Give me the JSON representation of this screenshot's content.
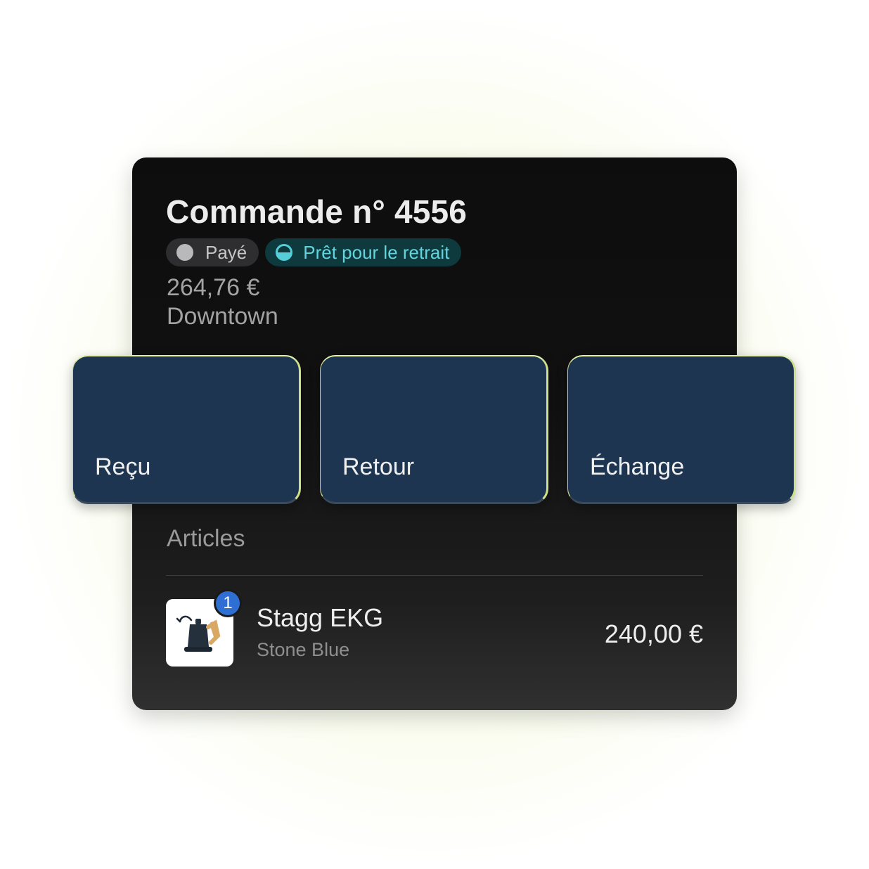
{
  "order": {
    "title": "Commande n° 4556",
    "badges": {
      "payment": "Payé",
      "fulfillment": "Prêt pour le retrait"
    },
    "amount": "264,76 €",
    "location": "Downtown"
  },
  "actions": [
    {
      "label": "Reçu"
    },
    {
      "label": "Retour"
    },
    {
      "label": "Échange"
    }
  ],
  "articles": {
    "title": "Articles",
    "items": [
      {
        "name": "Stagg EKG",
        "variant": "Stone Blue",
        "price": "240,00 €",
        "quantity": "1",
        "icon": "kettle-icon"
      }
    ]
  },
  "colors": {
    "card_bg": "#0d0d0d",
    "action_bg": "#1d3550",
    "action_border": "#e2f2a6",
    "ready_badge_bg": "#0e3a3d",
    "ready_badge_text": "#63d4de",
    "quantity_badge": "#2f6fd4"
  }
}
